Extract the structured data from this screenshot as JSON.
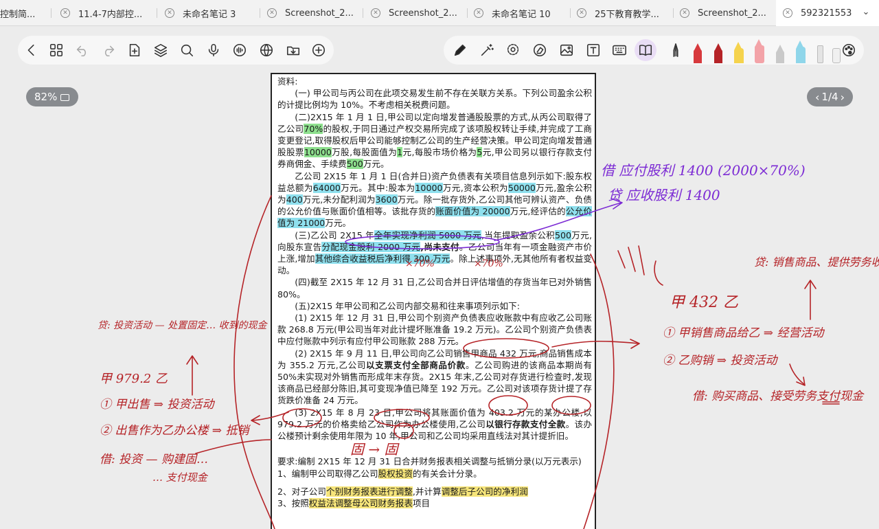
{
  "tabs": [
    {
      "label": "控制简...",
      "active": false
    },
    {
      "label": "11.4-7内部控...",
      "active": false
    },
    {
      "label": "未命名笔记 3",
      "active": false
    },
    {
      "label": "Screenshot_2...",
      "active": false
    },
    {
      "label": "Screenshot_2...",
      "active": false
    },
    {
      "label": "未命名笔记 10",
      "active": false
    },
    {
      "label": "25下教育教学...",
      "active": false
    },
    {
      "label": "Screenshot_2...",
      "active": false
    },
    {
      "label": "592321553",
      "active": true
    }
  ],
  "zoom": {
    "label": "82%"
  },
  "page_indicator": {
    "label": "1/4",
    "current": 1,
    "total": 4
  },
  "document": {
    "lines": {
      "l1": "资料:",
      "l2": "(一) 甲公司与丙公司在此项交易发生前不存在关联方关系。下列公司盈余公积的计提比例均为 10%。不考虑相关税费问题。",
      "p3a": "(二)2X15 年 1 月 1 日,甲公司以定向增发普通股股票的方式,从丙公司取得了乙公司",
      "p3b": "70%",
      "p3c": "的股权,于同日通过产权交易所完成了该项股权转让手续,并完成了工商变更登记,取得股权后甲公司能够控制乙公司的生产经营决策。甲公司定向增发普通股股票",
      "p3d": "10000",
      "p3e": "万股,每股面值为",
      "p3f": "1",
      "p3g": "元,每股市场价格为",
      "p3h": "5",
      "p3i": "元,甲公司另以银行存款支付券商佣金、手续费",
      "p3j": "500",
      "p3k": "万元。",
      "p4a": "乙公司 2X15 年 1 月 1 日(合并日)资产负债表有关项目信息列示如下:股东权益总额为",
      "p4b": "64000",
      "p4c": "万元。其中:股本为",
      "p4d": "10000",
      "p4e": "万元,资本公积为",
      "p4f": "50000",
      "p4g": "万元,盈余公积为",
      "p4h": "400",
      "p4i": "万元,未分配利润为",
      "p4j": "3600",
      "p4k": "万元。除一批存货外,乙公司其他可辨认资产、负债的公允价值与账面价值相等。该批存货的",
      "p4l": "账面价值为 20000",
      "p4m": "万元,经评估的",
      "p4n": "公允价值为 21000",
      "p4o": "万元。",
      "p5a": "(三)乙公司 2X15 年",
      "p5b": "全年实现净利润 5000 万元",
      "p5c": ",当年提取盈余公积",
      "p5d": "500",
      "p5e": "万元,向股东宣告",
      "p5f": "分配现金股利 2000 万元",
      "p5g": ",尚未支付",
      "p5h": "。乙公司当年有一项金融资产市价上涨,增加",
      "p5i": "其他综合收益税后净利得 300 万元",
      "p5j": "。除上述事项外,无其他所有者权益变动。",
      "p6": "(四)截至 2X15 年 12 月 31 日,乙公司合并日评估增值的存货当年已对外销售 80%。",
      "p7": "(五)2X15 年甲公司和乙公司内部交易和往来事项列示如下:",
      "p8": "(1) 2X15 年 12 月 31 日,甲公司个别资产负债表应收账款中有应收乙公司账款 268.8 万元(甲公司当年对此计提坏账准备 19.2 万元)。乙公司个别资产负债表中应付账款中列示有应付甲公司账款 288 万元。",
      "p9a": "(2) 2X15 年 9 月 11 日,甲公司向乙公司销售甲商品 432 万元,商品销售成本为 355.2 万元,乙公司",
      "p9b": "以支票支付全部商品价款",
      "p9c": "。乙公司购进的该商品本期尚有 50%未实现对外销售而形成年末存货。2X15 年末,乙公司对存货进行检查时,发现该商品已经部分陈旧,其可变现净值已降至 192 万元。乙公司对该项存货计提了存货跌价准备 24 万元。",
      "p10a": "(3) 2X15 年 8 月 23 日,甲公司将其账面价值为 403.2 万元的某办公楼,以 979.2 万元的价格卖给乙公司作为办公楼使用,乙公司",
      "p10b": "以银行存款支付全款",
      "p10c": "。该办公楼预计剩余使用年限为 10 年,甲公司和乙公司均采用直线法对其计提折旧。",
      "p11": "要求:编制 2X15 年 12 月 31 日合并财务报表相关调整与抵销分录(以万元表示)",
      "p12a": "1、编制甲公司取得乙公司",
      "p12b": "股权投资",
      "p12c": "的有关会计分录。",
      "p13a": "2、对子公司",
      "p13b": "个别财务报表进行调整",
      "p13c": ",并计算",
      "p13d": "调整后子公司的净利润",
      "p14a": "3、按照",
      "p14b": "权益法调整母公司财务报表",
      "p14c": "项目"
    }
  },
  "annotations": {
    "purple1": "借 应付股利 1400 (2000×70%)",
    "purple2": "贷 应收股利 1400",
    "x70a": "×70%",
    "x70b": "×70%",
    "left_top": "贷: 投资活动 — 处置固定… 收到的现金",
    "jia_979": "甲 979.2 乙",
    "left_1": "① 甲出售 ⇒ 投资活动",
    "left_2": "② 出售作为乙办公楼 ⇒ 抵销",
    "left_3": "借: 投资 — 购建固…",
    "left_4": "… 支付现金",
    "gu_gu": "固 → 固",
    "jia_432": "甲 432 乙",
    "right_1": "① 甲销售商品给乙 ⇒ 经营活动",
    "right_2": "② 乙购销 ⇒ 投资活动",
    "right_3": "借: 购买商品、接受劳务支付现金",
    "right_top": "贷: 销售商品、提供劳务收到 现金"
  },
  "colors": {
    "ink_red": "#b52327",
    "ink_purple": "#7c2bd4",
    "hl_green": "#8ee08e",
    "hl_blue": "#8fe0ee",
    "hl_yellow": "#f6e57a"
  },
  "toolbar": {
    "left_icons": [
      "back-icon",
      "grid-icon",
      "undo-icon",
      "redo-icon",
      "add-page-icon",
      "layers-icon",
      "search-icon",
      "microphone-icon",
      "audio-icon",
      "globe-icon",
      "import-icon",
      "add-icon"
    ],
    "right_icons": [
      "pen-icon",
      "magic-pen-icon",
      "lasso-icon",
      "eraser-icon",
      "image-icon",
      "textbox-icon",
      "keyboard-icon",
      "reader-icon",
      "fountain-pen-tool",
      "red-pen-tool",
      "dark-red-pen-tool",
      "yellow-highlighter-tool",
      "pink-highlighter-tool",
      "pencil-tool",
      "blue-highlighter-tool",
      "ruler-tool",
      "eraser-tool",
      "palette-icon"
    ]
  }
}
